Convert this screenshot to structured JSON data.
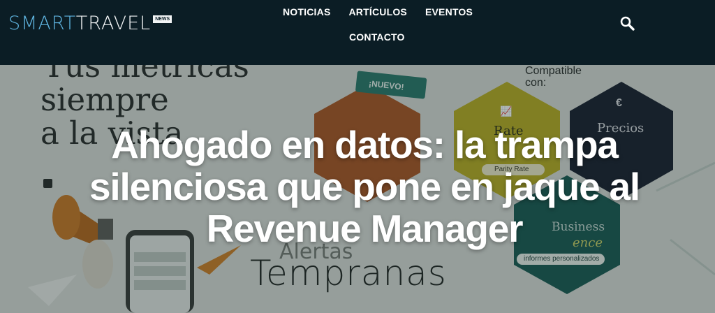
{
  "brand": {
    "logo_part1": "SMART",
    "logo_part2": "TRAVEL",
    "logo_badge": "NEWS",
    "colors": {
      "logo_accent": "#5fb4e0",
      "header_bg": "#0b1d25"
    }
  },
  "nav": {
    "items": [
      "NOTICIAS",
      "ARTÍCULOS",
      "EVENTOS",
      "CONTACTO"
    ],
    "search_icon": "search-icon"
  },
  "hero": {
    "headline": "Ahogado en datos: la trampa silenciosa que pone en jaque al Revenue Manager",
    "image_text": {
      "serif_line1": "Tus métricas",
      "serif_line2": "siempre",
      "serif_line3": "a la vista",
      "compatible": "Compatible con:",
      "nuevo_badge": "¡NUEVO!",
      "rate_label": "Rate",
      "parity_tag": "Parity Rate",
      "precios_label": "Precios",
      "euro_symbol": "€",
      "business_label": "Business",
      "ence_label": "ence",
      "informes_tag": "informes personalizados",
      "alertas": "Alertas",
      "tempranas": "Tempranas"
    }
  }
}
